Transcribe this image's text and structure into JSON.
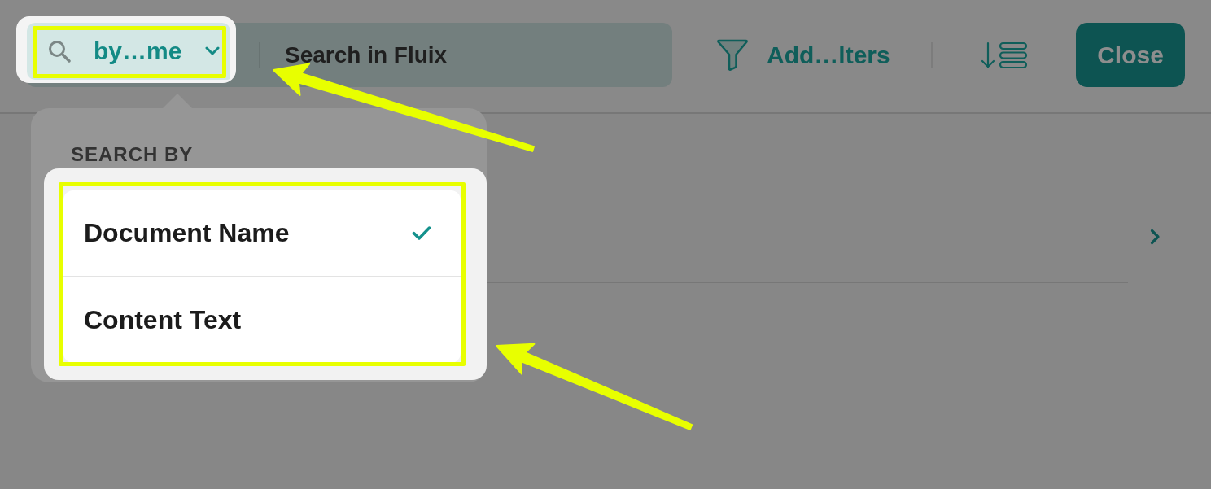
{
  "toolbar": {
    "search_scope": {
      "label": "by…me"
    },
    "search": {
      "placeholder": "Search in Fluix"
    },
    "filters_button": {
      "label": "Add…lters"
    },
    "close_button": {
      "label": "Close"
    }
  },
  "popover": {
    "title": "SEARCH BY",
    "options": [
      {
        "label": "Document Name",
        "selected": true
      },
      {
        "label": "Content Text",
        "selected": false
      }
    ]
  }
}
